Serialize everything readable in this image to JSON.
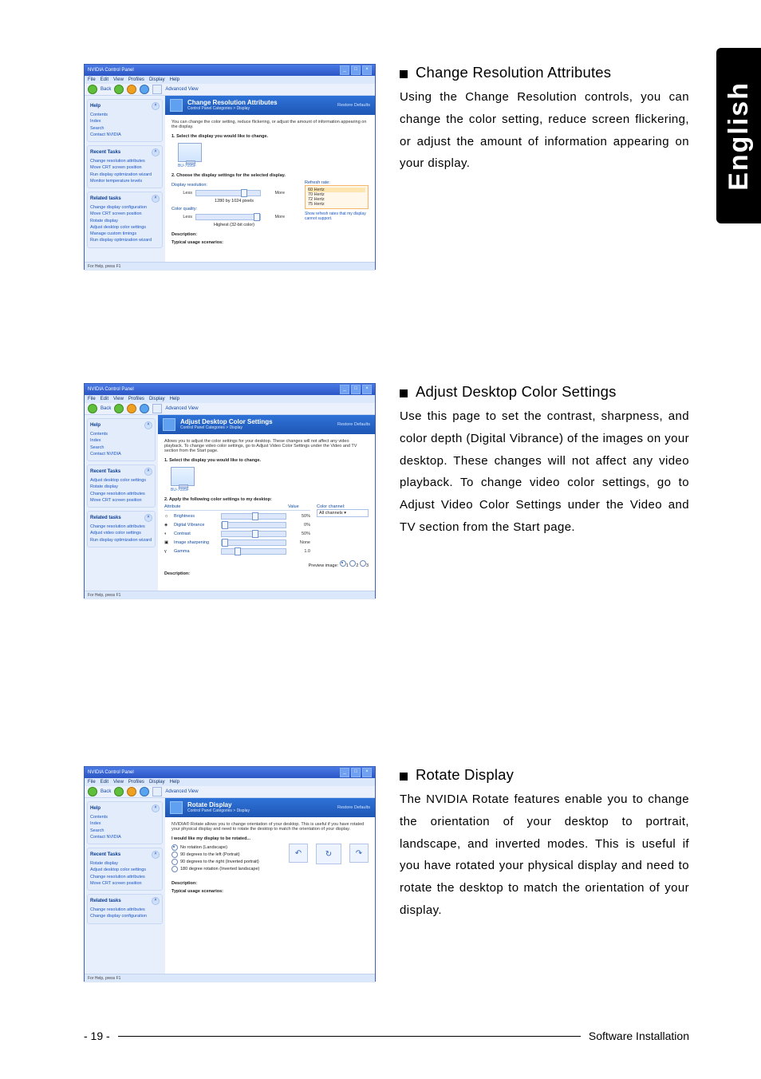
{
  "lang_tab": "English",
  "footer": {
    "page": "- 19 -",
    "section": "Software Installation"
  },
  "app": {
    "window_title": "NVIDIA Control Panel",
    "menubar": [
      "File",
      "Edit",
      "View",
      "Profiles",
      "Display",
      "Help"
    ],
    "toolbar": {
      "back": "Back",
      "view_mode": "Advanced View"
    },
    "statusbar": "For Help, press F1",
    "restore": "Restore Defaults"
  },
  "sidebar": {
    "help": {
      "head": "Help",
      "items": [
        "Contents",
        "Index",
        "Search",
        "Contact NVIDIA"
      ]
    },
    "recent_head": "Recent Tasks",
    "related_head": "Related tasks"
  },
  "s1": {
    "title": "Change Resolution Attributes",
    "breadcrumb": "Control Panel Categories > Display",
    "intro": "You can change the color setting, reduce flickering, or adjust the amount of information appearing on the display.",
    "step1": "1. Select the display you would like to change.",
    "monitor_label": "BU-7095F",
    "step2": "2. Choose the display settings for the selected display.",
    "res_label": "Display resolution:",
    "res_less": "Less",
    "res_more": "More",
    "res_value": "1280 by 1024 pixels",
    "qual_label": "Color quality:",
    "qual_less": "Less",
    "qual_more": "More",
    "qual_value": "Highest (32-bit color)",
    "refresh_label": "Refresh rate:",
    "refresh_options": [
      "60 Hertz",
      "70 Hertz",
      "72 Hertz",
      "75 Hertz"
    ],
    "refresh_link": "Show refresh rates that my display cannot support.",
    "desc_h": "Description:",
    "usage_h": "Typical usage scenarios:",
    "recent": [
      "Change resolution attributes",
      "Move CRT screen position",
      "Run display optimization wizard",
      "Monitor temperature levels"
    ],
    "related": [
      "Change display configuration",
      "Move CRT screen position",
      "Rotate display",
      "Adjust desktop color settings",
      "Manage custom timings",
      "Run display optimization wizard"
    ],
    "desc_title": "Change Resolution Attributes",
    "desc_body": "Using the Change Resolution controls, you can change the color setting, reduce screen flickering, or adjust the amount of information appearing on your display."
  },
  "s2": {
    "title": "Adjust Desktop Color Settings",
    "breadcrumb": "Control Panel Categories > Display",
    "intro": "Allows you to adjust the color settings for your desktop. These changes will not affect any video playback. To change video color settings, go to Adjust Video Color Settings under the Video and TV section from the Start page.",
    "step1": "1. Select the display you would like to change.",
    "monitor_label": "BU-7095F",
    "step2": "2. Apply the following color settings to my desktop:",
    "table_head": [
      "Attribute",
      "Value"
    ],
    "sliders": [
      {
        "name": "Brightness",
        "value": "50%"
      },
      {
        "name": "Digital Vibrance",
        "value": "0%"
      },
      {
        "name": "Contrast",
        "value": "50%"
      },
      {
        "name": "Image sharpening",
        "value": "None"
      },
      {
        "name": "Gamma",
        "value": "1.0"
      }
    ],
    "cc_label": "Color channel:",
    "cc_value": "All channels",
    "preview": "Preview image:",
    "desc_h": "Description:",
    "recent": [
      "Adjust desktop color settings",
      "Rotate display",
      "Change resolution attributes",
      "Move CRT screen position"
    ],
    "related": [
      "Change resolution attributes",
      "Adjust video color settings",
      "Run display optimization wizard"
    ],
    "desc_title": "Adjust Desktop Color Settings",
    "desc_body": "Use this page to set the contrast, sharpness, and color depth (Digital Vibrance) of the images on your desktop. These changes will not affect any video playback. To change video color settings, go to Adjust Video Color Settings under the Video and TV section from the Start page."
  },
  "s3": {
    "title": "Rotate Display",
    "breadcrumb": "Control Panel Categories > Display",
    "intro": "NVIDIA® Rotate allows you to change orientation of your desktop. This is useful if you have rotated your physical display and need to rotate the desktop to match the orientation of your display.",
    "step_h": "I would like my display to be rotated...",
    "options": [
      "No rotation (Landscape)",
      "90 degrees to the left (Portrait)",
      "90 degrees to the right (Inverted portrait)",
      "180 degree rotation (Inverted landscape)"
    ],
    "desc_h": "Description:",
    "usage_h": "Typical usage scenarios:",
    "recent": [
      "Rotate display",
      "Adjust desktop color settings",
      "Change resolution attributes",
      "Move CRT screen position"
    ],
    "related": [
      "Change resolution attributes",
      "Change display configuration"
    ],
    "desc_title": "Rotate Display",
    "desc_body": "The NVIDIA Rotate features enable you to change the orientation of your desktop to portrait, landscape, and inverted modes. This is useful if you have rotated your physical display and need to rotate the desktop to match the orientation of your display."
  }
}
